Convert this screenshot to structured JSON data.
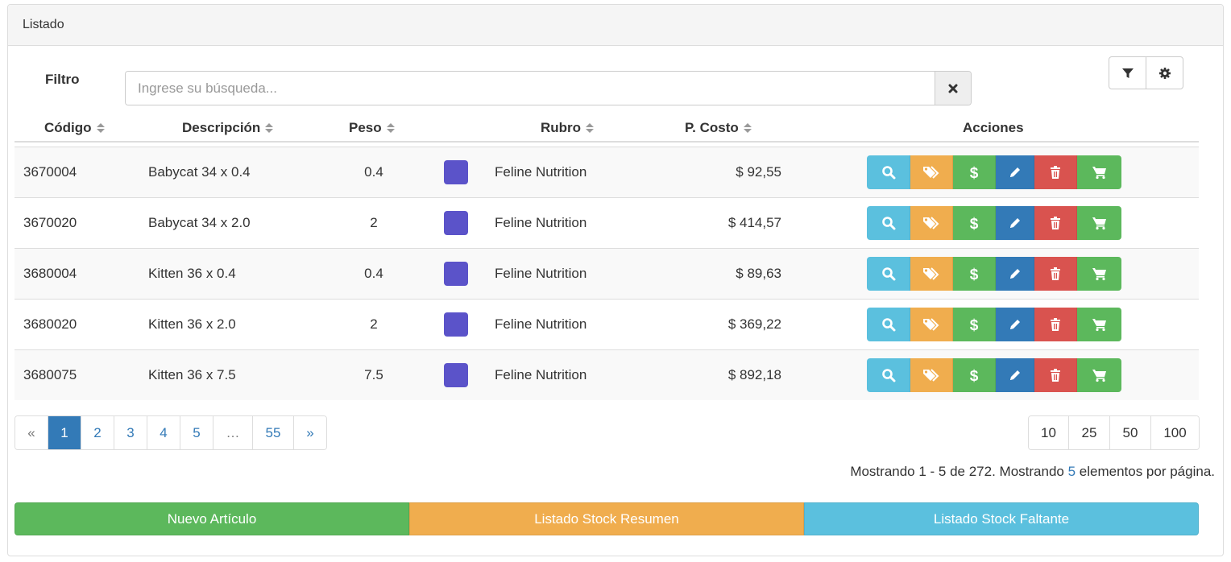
{
  "panel": {
    "title": "Listado"
  },
  "filter": {
    "label": "Filtro",
    "placeholder": "Ingrese su búsqueda...",
    "value": "",
    "clear_icon": "times-icon"
  },
  "toolbar": {
    "filter_icon": "filter-icon",
    "settings_icon": "gear-icon"
  },
  "table": {
    "columns": [
      "Código",
      "Descripción",
      "Peso",
      "Rubro",
      "P. Costo",
      "Acciones"
    ],
    "rows": [
      {
        "codigo": "3670004",
        "descripcion": "Babycat 34 x 0.4",
        "peso": "0.4",
        "color": "#5b53c9",
        "rubro": "Feline Nutrition",
        "costo": "$ 92,55"
      },
      {
        "codigo": "3670020",
        "descripcion": "Babycat 34 x 2.0",
        "peso": "2",
        "color": "#5b53c9",
        "rubro": "Feline Nutrition",
        "costo": "$ 414,57"
      },
      {
        "codigo": "3680004",
        "descripcion": "Kitten 36 x 0.4",
        "peso": "0.4",
        "color": "#5b53c9",
        "rubro": "Feline Nutrition",
        "costo": "$ 89,63"
      },
      {
        "codigo": "3680020",
        "descripcion": "Kitten 36 x 2.0",
        "peso": "2",
        "color": "#5b53c9",
        "rubro": "Feline Nutrition",
        "costo": "$ 369,22"
      },
      {
        "codigo": "3680075",
        "descripcion": "Kitten 36 x 7.5",
        "peso": "7.5",
        "color": "#5b53c9",
        "rubro": "Feline Nutrition",
        "costo": "$ 892,18"
      }
    ],
    "actions": [
      {
        "name": "view",
        "icon": "search-icon",
        "color": "#5bc0de"
      },
      {
        "name": "tags",
        "icon": "tags-icon",
        "color": "#f0ad4e"
      },
      {
        "name": "price",
        "icon": "dollar-icon",
        "color": "#5cb85c"
      },
      {
        "name": "edit",
        "icon": "pencil-icon",
        "color": "#337ab7"
      },
      {
        "name": "delete",
        "icon": "trash-icon",
        "color": "#d9534f"
      },
      {
        "name": "cart",
        "icon": "cart-icon",
        "color": "#5cb85c"
      }
    ]
  },
  "pagination": {
    "items": [
      "«",
      "1",
      "2",
      "3",
      "4",
      "5",
      "…",
      "55",
      "»"
    ],
    "active": "1"
  },
  "page_sizes": [
    "10",
    "25",
    "50",
    "100"
  ],
  "status": {
    "prefix": "Mostrando 1 - 5 de 272. Mostrando ",
    "per_page": "5",
    "suffix": " elementos por página."
  },
  "bottom_buttons": {
    "new_article": "Nuevo Artículo",
    "stock_summary": "Listado Stock Resumen",
    "stock_missing": "Listado Stock Faltante"
  },
  "colors": {
    "primary": "#337ab7",
    "info": "#5bc0de",
    "warning": "#f0ad4e",
    "success": "#5cb85c",
    "danger": "#d9534f",
    "swatch": "#5b53c9"
  }
}
